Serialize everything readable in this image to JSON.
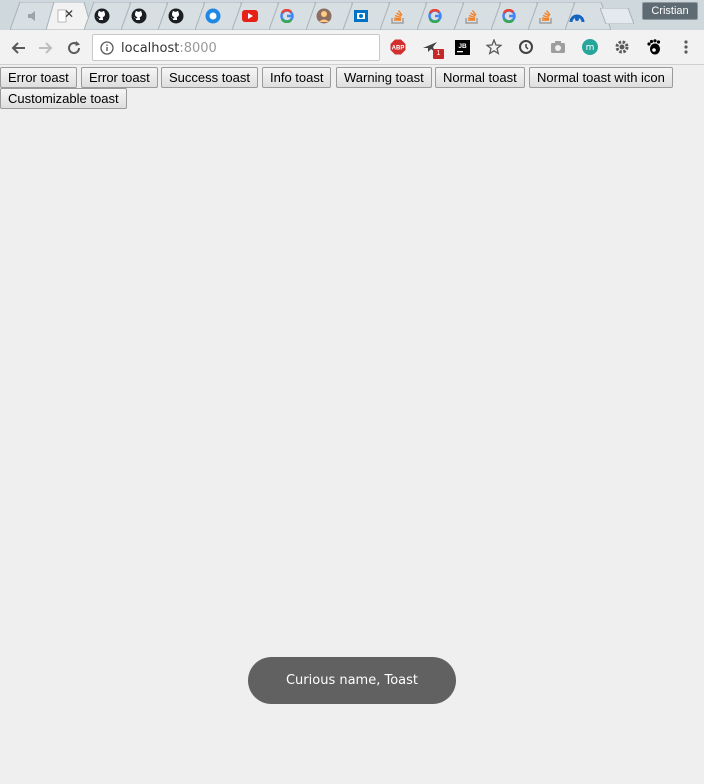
{
  "browser": {
    "profile_name": "Cristian",
    "tabs": [
      {
        "icon": "speaker-icon",
        "active": false
      },
      {
        "icon": "blank-page-icon",
        "active": true,
        "close": "✕"
      },
      {
        "icon": "github-icon",
        "active": false
      },
      {
        "icon": "github-icon",
        "active": false
      },
      {
        "icon": "github-icon",
        "active": false
      },
      {
        "icon": "blue-circle-icon",
        "active": false
      },
      {
        "icon": "youtube-icon",
        "active": false
      },
      {
        "icon": "google-icon",
        "active": false
      },
      {
        "icon": "avatar-icon",
        "active": false
      },
      {
        "icon": "outlook-icon",
        "active": false
      },
      {
        "icon": "stackoverflow-icon",
        "active": false
      },
      {
        "icon": "google-icon",
        "active": false
      },
      {
        "icon": "stackoverflow-icon",
        "active": false
      },
      {
        "icon": "google-icon",
        "active": false
      },
      {
        "icon": "stackoverflow-icon",
        "active": false
      },
      {
        "icon": "chrome-remote-icon",
        "active": false
      }
    ],
    "url": {
      "host": "localhost",
      "port": ":8000"
    },
    "extensions": [
      {
        "name": "adblock-plus-icon",
        "label": "ABP"
      },
      {
        "name": "airplane-extension-icon",
        "badge": "1"
      },
      {
        "name": "jetbrains-icon",
        "label": "JB"
      },
      {
        "name": "bookmark-star-icon"
      },
      {
        "name": "sync-extension-icon"
      },
      {
        "name": "camera-icon"
      },
      {
        "name": "m-extension-icon",
        "label": "m"
      },
      {
        "name": "gear-extension-icon"
      },
      {
        "name": "gnome-icon"
      },
      {
        "name": "chrome-menu-icon"
      }
    ],
    "colors": {
      "tabstrip": "#cfd8dc",
      "toolbar": "#f2f2f2",
      "page_bg": "#efefef"
    }
  },
  "page": {
    "buttons": [
      "Error toast",
      "Error toast",
      "Success toast",
      "Info toast",
      "Warning toast",
      "Normal toast",
      "Normal toast with icon",
      "Customizable toast"
    ],
    "toast": {
      "text": "Curious name, Toast",
      "color": "#616161"
    }
  }
}
